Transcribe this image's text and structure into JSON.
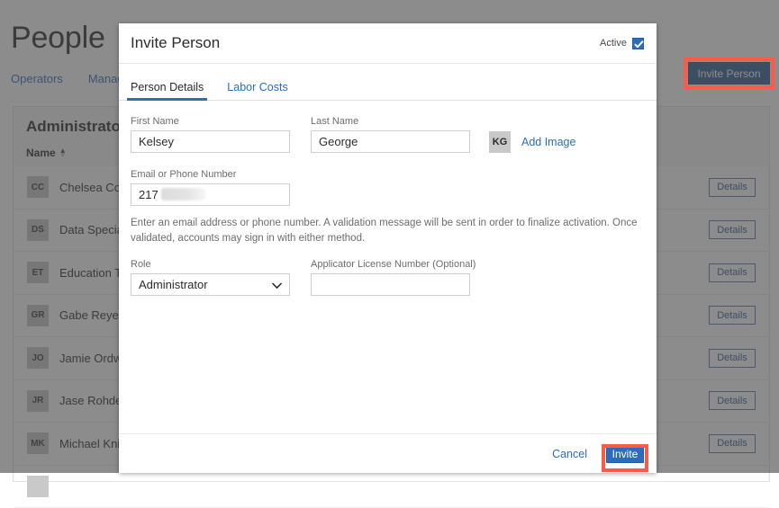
{
  "background": {
    "page_title": "People",
    "nav_items": [
      {
        "label": "Operators"
      },
      {
        "label": "Manage"
      }
    ],
    "invite_person_button": "Invite Person",
    "card": {
      "title": "Administrators",
      "column_header": "Name",
      "sort_direction": "ascending",
      "details_label": "Details",
      "rows": [
        {
          "initials": "CC",
          "name": "Chelsea Coulter"
        },
        {
          "initials": "DS",
          "name": "Data Specialists"
        },
        {
          "initials": "ET",
          "name": "Education Team"
        },
        {
          "initials": "GR",
          "name": "Gabe Reyes"
        },
        {
          "initials": "JO",
          "name": "Jamie Ordway"
        },
        {
          "initials": "JR",
          "name": "Jase Rohde"
        },
        {
          "initials": "MK",
          "name": "Michael Knight"
        },
        {
          "initials": "",
          "name": ""
        }
      ]
    }
  },
  "modal": {
    "title": "Invite Person",
    "active_label": "Active",
    "active_checked": true,
    "tabs": [
      {
        "label": "Person Details",
        "active": true
      },
      {
        "label": "Labor Costs",
        "active": false
      }
    ],
    "fields": {
      "first_name_label": "First Name",
      "first_name_value": "Kelsey",
      "last_name_label": "Last Name",
      "last_name_value": "George",
      "avatar_initials": "KG",
      "add_image_label": "Add Image",
      "email_label": "Email or Phone Number",
      "email_value": "217",
      "email_help": "Enter an email address or phone number. A validation message will be sent in order to finalize activation. Once validated, accounts may sign in with either method.",
      "role_label": "Role",
      "role_value": "Administrator",
      "role_options": [
        "Administrator"
      ],
      "license_label": "Applicator License Number (Optional)",
      "license_value": "",
      "license_placeholder": ""
    },
    "footer": {
      "cancel_label": "Cancel",
      "invite_label": "Invite"
    }
  },
  "colors": {
    "accent_blue": "#2a6ebb",
    "dark_blue": "#2a5d96",
    "highlight_red": "#ff5a47",
    "avatar_gray": "#c9c9c9"
  }
}
